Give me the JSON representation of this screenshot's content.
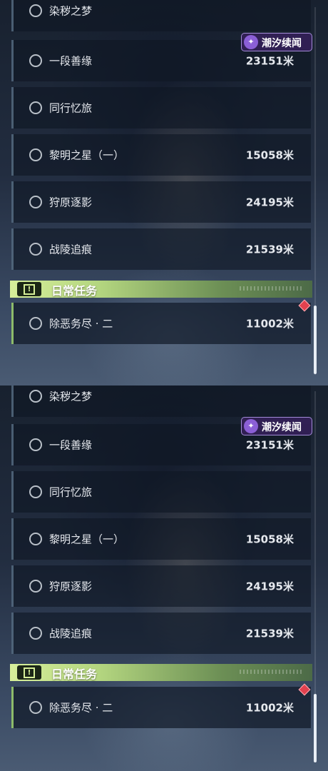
{
  "quests": [
    {
      "label": "染秽之梦",
      "distance": ""
    },
    {
      "label": "一段善缘",
      "distance": "23151米"
    },
    {
      "label": "同行忆旅",
      "distance": ""
    },
    {
      "label": "黎明之星（一）",
      "distance": "15058米"
    },
    {
      "label": "狩原逐影",
      "distance": "24195米"
    },
    {
      "label": "战陵追痕",
      "distance": "21539米"
    }
  ],
  "event_badge": {
    "icon": "tide-icon",
    "label": "潮汐续闻"
  },
  "daily_section": {
    "icon": "exclamation-icon",
    "title": "日常任务"
  },
  "daily_quests": [
    {
      "label": "除恶务尽 · 二",
      "distance": "11002米"
    }
  ],
  "colors": {
    "accent_green": "#b3d57f",
    "event_purple": "#8b5fd6",
    "marker_red": "#e2414f"
  }
}
